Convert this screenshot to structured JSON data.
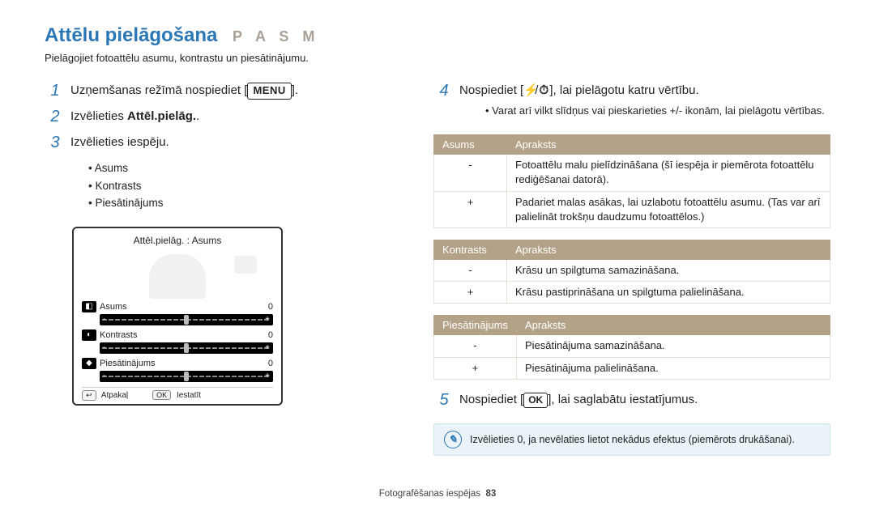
{
  "header": {
    "title": "Attēlu pielāgošana",
    "modes": "P A S M",
    "subtitle": "Pielāgojiet fotoattēlu asumu, kontrastu un piesātinājumu."
  },
  "left": {
    "step1_pre": "Uzņemšanas režīmā nospiediet [",
    "step1_menu": "MENU",
    "step1_post": "].",
    "step2_pre": "Izvēlieties ",
    "step2_strong": "Attēl.pielāg.",
    "step2_post": ".",
    "step3": "Izvēlieties iespēju.",
    "options": [
      "Asums",
      "Kontrasts",
      "Piesātinājums"
    ],
    "lcd": {
      "title": "Attēl.pielāg. : Asums",
      "rows": [
        {
          "icon": "◧",
          "label": "Asums",
          "value": "0"
        },
        {
          "icon": "◐",
          "label": "Kontrasts",
          "value": "0"
        },
        {
          "icon": "◆",
          "label": "Piesātinājums",
          "value": "0"
        }
      ],
      "back_btn": "↩",
      "back_label": "Atpakaļ",
      "ok_btn": "OK",
      "ok_label": "Iestatīt"
    }
  },
  "right": {
    "step4_pre": "Nospiediet [",
    "step4_icon1": "⚡",
    "step4_sep": "/",
    "step4_icon2": "⏱",
    "step4_post": "], lai pielāgotu katru vērtību.",
    "step4_sub": [
      "Varat arī vilkt slīdņus vai pieskarieties +/- ikonām, lai pielāgotu vērtības."
    ],
    "tables": [
      {
        "head1": "Asums",
        "head2": "Apraksts",
        "rows": [
          {
            "sym": "-",
            "text": "Fotoattēlu malu pielīdzināšana (šī iespēja ir piemērota fotoattēlu rediģēšanai datorā)."
          },
          {
            "sym": "+",
            "text": "Padariet malas asākas, lai uzlabotu fotoattēlu asumu. (Tas var arī palielināt trokšņu daudzumu fotoattēlos.)"
          }
        ]
      },
      {
        "head1": "Kontrasts",
        "head2": "Apraksts",
        "rows": [
          {
            "sym": "-",
            "text": "Krāsu un spilgtuma samazināšana."
          },
          {
            "sym": "+",
            "text": "Krāsu pastiprināšana un spilgtuma palielināšana."
          }
        ]
      },
      {
        "head1": "Piesātinājums",
        "head2": "Apraksts",
        "rows": [
          {
            "sym": "-",
            "text": "Piesātinājuma samazināšana."
          },
          {
            "sym": "+",
            "text": "Piesātinājuma palielināšana."
          }
        ]
      }
    ],
    "step5_pre": "Nospiediet [",
    "step5_ok": "OK",
    "step5_post": "], lai saglabātu iestatījumus.",
    "note": "Izvēlieties 0, ja nevēlaties lietot nekādus efektus (piemērots drukāšanai)."
  },
  "footer": {
    "section": "Fotografēšanas iespējas",
    "page": "83"
  }
}
